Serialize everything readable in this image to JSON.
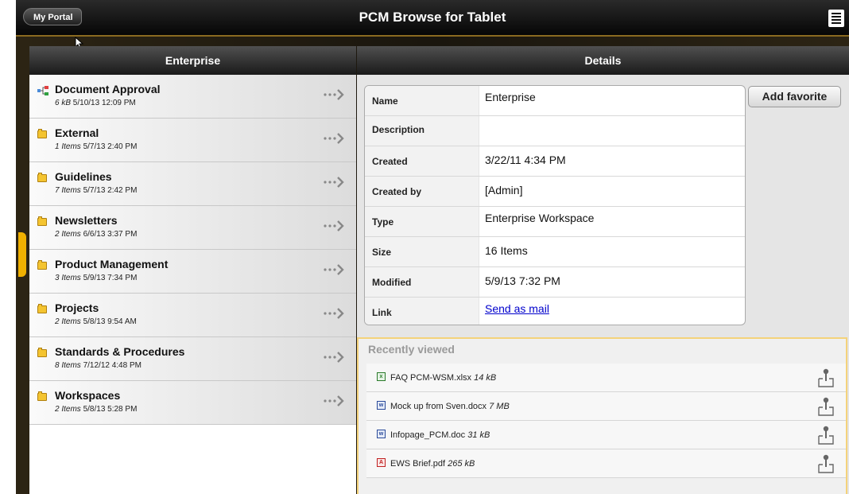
{
  "topbar": {
    "portal_label": "My Portal",
    "title": "PCM Browse for Tablet"
  },
  "left_panel": {
    "header": "Enterprise",
    "items": [
      {
        "name": "Document Approval",
        "count": "6 kB",
        "date": "5/10/13 12:09 PM",
        "icon": "workflow-icon"
      },
      {
        "name": "External",
        "count": "1 Items",
        "date": "5/7/13 2:40 PM",
        "icon": "folder-icon"
      },
      {
        "name": "Guidelines",
        "count": "7 Items",
        "date": "5/7/13 2:42 PM",
        "icon": "folder-icon"
      },
      {
        "name": "Newsletters",
        "count": "2 Items",
        "date": "6/6/13 3:37 PM",
        "icon": "folder-icon"
      },
      {
        "name": "Product Management",
        "count": "3 Items",
        "date": "5/9/13 7:34 PM",
        "icon": "folder-icon"
      },
      {
        "name": "Projects",
        "count": "2 Items",
        "date": "5/8/13 9:54 AM",
        "icon": "folder-icon"
      },
      {
        "name": "Standards & Procedures",
        "count": "8 Items",
        "date": "7/12/12 4:48 PM",
        "icon": "folder-icon"
      },
      {
        "name": "Workspaces",
        "count": "2 Items",
        "date": "5/8/13 5:28 PM",
        "icon": "folder-icon"
      }
    ]
  },
  "right_panel": {
    "header": "Details",
    "add_favorite_label": "Add favorite",
    "details": [
      {
        "label": "Name",
        "value": "Enterprise"
      },
      {
        "label": "Description",
        "value": ""
      },
      {
        "label": "Created",
        "value": "3/22/11 4:34 PM"
      },
      {
        "label": "Created by",
        "value": "[Admin]"
      },
      {
        "label": "Type",
        "value": "Enterprise Workspace"
      },
      {
        "label": "Size",
        "value": "16 Items"
      },
      {
        "label": "Modified",
        "value": "5/9/13 7:32 PM"
      },
      {
        "label": "Link",
        "value": "Send as mail"
      }
    ],
    "recent_title": "Recently viewed",
    "recent_items": [
      {
        "name": "FAQ PCM-WSM.xlsx",
        "size": "14 kB",
        "icon": "excel-icon"
      },
      {
        "name": "Mock up from Sven.docx",
        "size": "7 MB",
        "icon": "word-icon"
      },
      {
        "name": "Infopage_PCM.doc",
        "size": "31 kB",
        "icon": "word-icon"
      },
      {
        "name": "EWS Brief.pdf",
        "size": "265 kB",
        "icon": "pdf-icon"
      }
    ]
  }
}
